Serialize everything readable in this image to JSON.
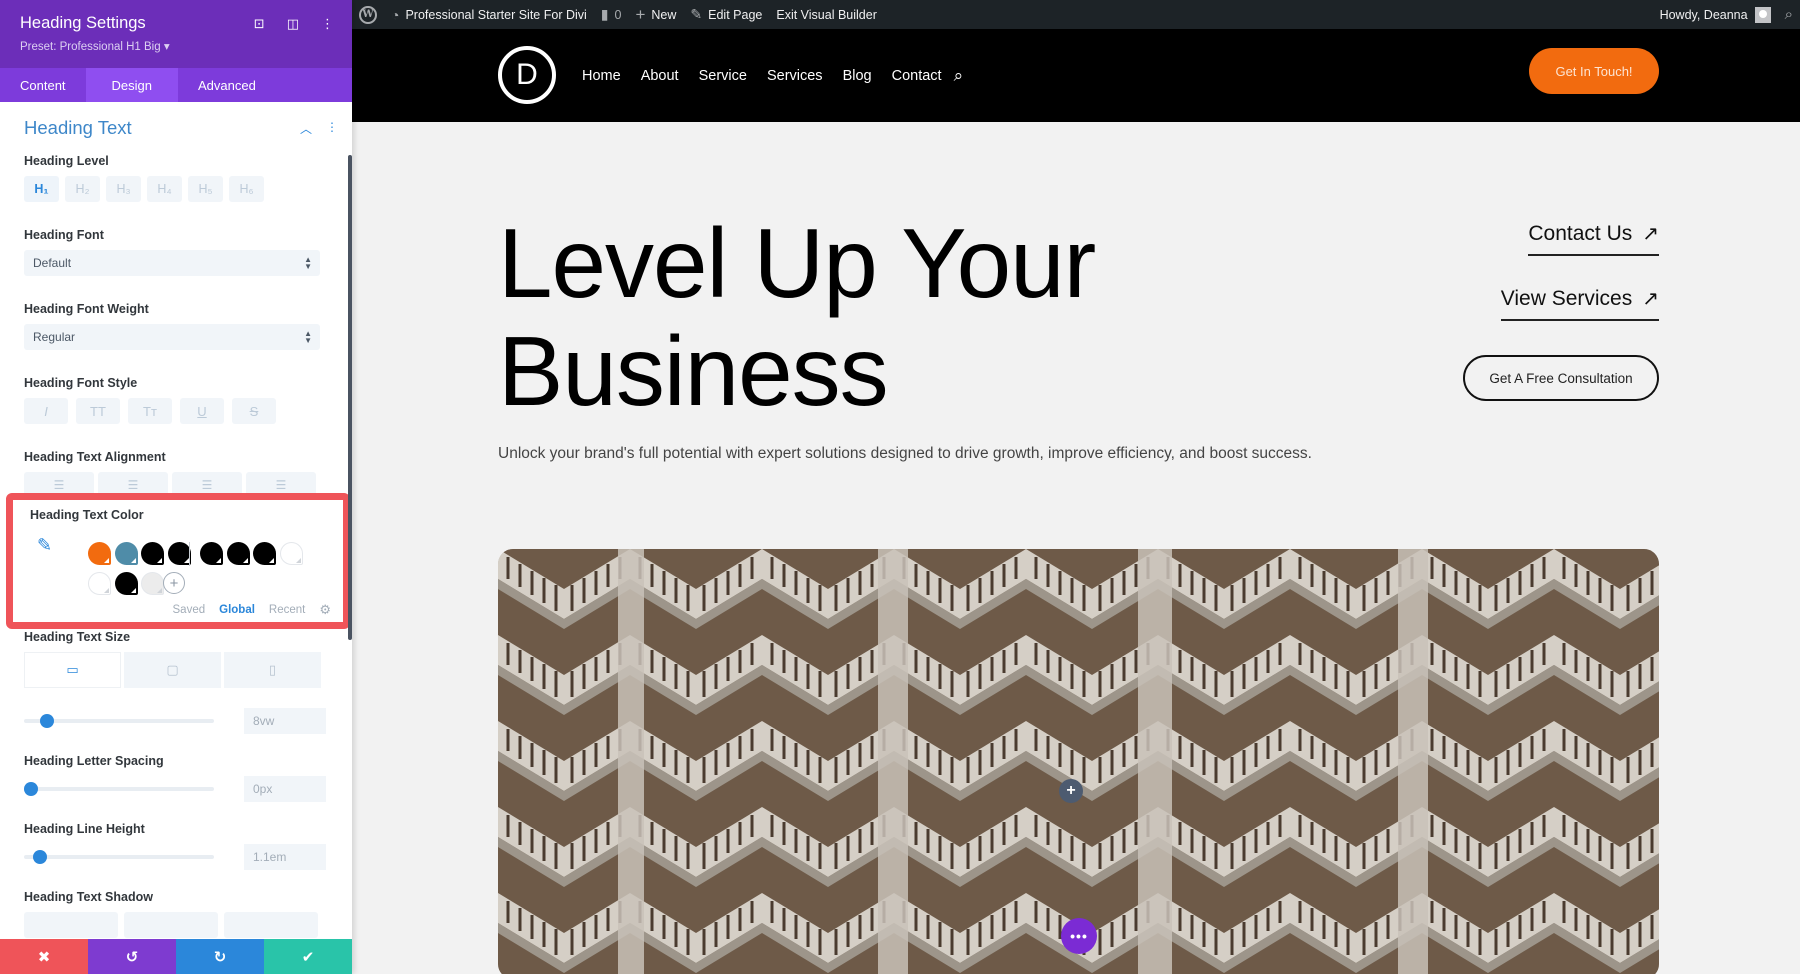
{
  "wpbar": {
    "site_name": "Professional Starter Site For Divi",
    "comments_count": "0",
    "new_label": "New",
    "edit_label": "Edit Page",
    "exit_label": "Exit Visual Builder",
    "howdy": "Howdy, Deanna"
  },
  "panel": {
    "title": "Heading Settings",
    "preset": "Preset: Professional H1 Big ▾",
    "tabs": [
      {
        "label": "Content",
        "active": false
      },
      {
        "label": "Design",
        "active": true
      },
      {
        "label": "Advanced",
        "active": false
      }
    ],
    "section_title": "Heading Text",
    "heading_level": {
      "label": "Heading Level",
      "options": [
        "H₁",
        "H₂",
        "H₃",
        "H₄",
        "H₅",
        "H₆"
      ],
      "selected": "H₁"
    },
    "heading_font": {
      "label": "Heading Font",
      "value": "Default"
    },
    "heading_font_weight": {
      "label": "Heading Font Weight",
      "value": "Regular"
    },
    "heading_font_style": {
      "label": "Heading Font Style",
      "options": [
        "I",
        "TT",
        "Tᴛ",
        "U",
        "S"
      ]
    },
    "heading_text_alignment": {
      "label": "Heading Text Alignment",
      "options": [
        "left",
        "center",
        "right",
        "justify"
      ]
    },
    "heading_text_color": {
      "label": "Heading Text Color",
      "swatches_row1": [
        "#f26b0f",
        "#4f8ca8",
        "#000000",
        "#000000",
        "#000000",
        "#000000",
        "#000000",
        "#ffffff"
      ],
      "swatches_row2": [
        "#ffffff",
        "#000000",
        "#ececec"
      ],
      "tabs": [
        {
          "label": "Saved",
          "active": false
        },
        {
          "label": "Global",
          "active": true
        },
        {
          "label": "Recent",
          "active": false
        }
      ]
    },
    "heading_text_size": {
      "label": "Heading Text Size",
      "devices": [
        "desktop",
        "tablet",
        "phone"
      ],
      "value": "8vw",
      "slider_fraction": 0.09
    },
    "heading_letter_spacing": {
      "label": "Heading Letter Spacing",
      "value": "0px",
      "slider_fraction": 0.0
    },
    "heading_line_height": {
      "label": "Heading Line Height",
      "value": "1.1em",
      "slider_fraction": 0.05
    },
    "heading_text_shadow": {
      "label": "Heading Text Shadow"
    },
    "actions": {
      "discard": "✖",
      "undo": "↺",
      "redo": "↻",
      "save": "✔"
    },
    "colors": {
      "header": "#6c2eb9",
      "tabs": "#7d3bdb",
      "accent": "#2b87da",
      "discard": "#ef5459",
      "undo": "#7e3bd0",
      "redo": "#2b87da",
      "save": "#29c4a9",
      "highlight": "#ef5459"
    }
  },
  "site": {
    "logo_letter": "D",
    "nav": [
      "Home",
      "About",
      "Service",
      "Services",
      "Blog",
      "Contact"
    ],
    "cta": "Get In Touch!",
    "hero_line1": "Level Up Your",
    "hero_line2": "Business",
    "subtitle": "Unlock your brand's full potential with expert solutions designed to drive growth, improve efficiency, and boost success.",
    "link1": "Contact Us",
    "link2": "View Services",
    "outline_button": "Get A Free Consultation",
    "arrow": "↗",
    "accent": "#f26b0f"
  }
}
